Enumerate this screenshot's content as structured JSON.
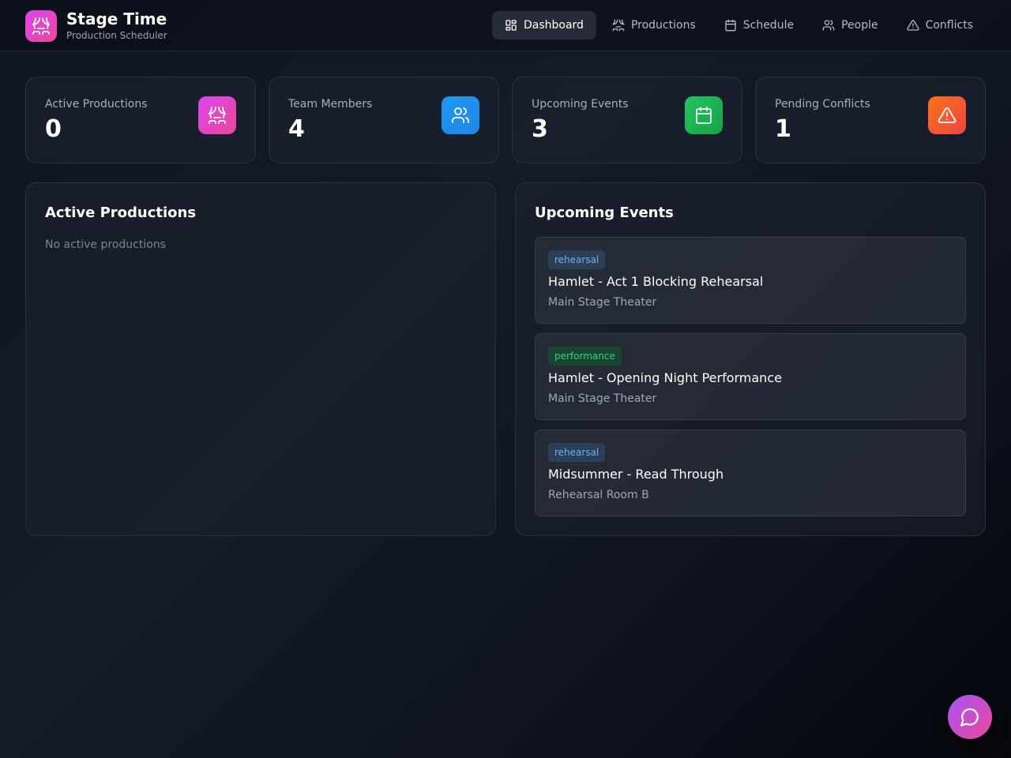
{
  "app": {
    "title": "Stage Time",
    "subtitle": "Production Scheduler",
    "logo_icon": "theater-icon"
  },
  "nav": [
    {
      "label": "Dashboard",
      "icon": "dashboard-icon",
      "active": true
    },
    {
      "label": "Productions",
      "icon": "theater-icon",
      "active": false
    },
    {
      "label": "Schedule",
      "icon": "calendar-icon",
      "active": false
    },
    {
      "label": "People",
      "icon": "users-icon",
      "active": false
    },
    {
      "label": "Conflicts",
      "icon": "warning-icon",
      "active": false
    }
  ],
  "stats": [
    {
      "label": "Active Productions",
      "value": "0",
      "icon": "theater-icon",
      "color": "#d946ef"
    },
    {
      "label": "Team Members",
      "value": "4",
      "icon": "users-icon",
      "color": "#2196f3"
    },
    {
      "label": "Upcoming Events",
      "value": "3",
      "icon": "calendar-icon",
      "color": "#22c55e"
    },
    {
      "label": "Pending Conflicts",
      "value": "1",
      "icon": "warning-icon",
      "color": "#f97316"
    }
  ],
  "active_productions": {
    "title": "Active Productions",
    "empty_text": "No active productions"
  },
  "upcoming_events": {
    "title": "Upcoming Events",
    "events": [
      {
        "type": "rehearsal",
        "title": "Hamlet - Act 1 Blocking Rehearsal",
        "location": "Main Stage Theater"
      },
      {
        "type": "performance",
        "title": "Hamlet - Opening Night Performance",
        "location": "Main Stage Theater"
      },
      {
        "type": "rehearsal",
        "title": "Midsummer - Read Through",
        "location": "Rehearsal Room B"
      }
    ]
  },
  "chat_button": {
    "icon": "chat-icon"
  }
}
